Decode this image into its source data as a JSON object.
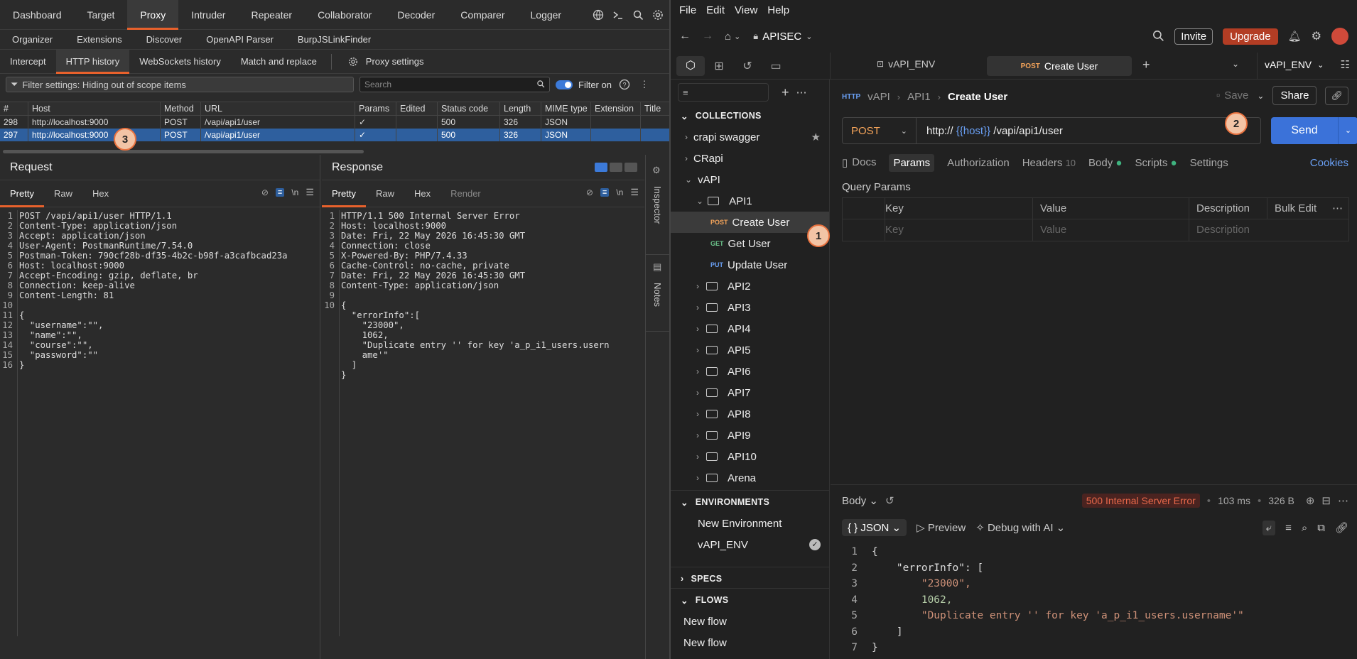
{
  "burp": {
    "top_tabs": [
      "Dashboard",
      "Target",
      "Proxy",
      "Intruder",
      "Repeater",
      "Collaborator",
      "Decoder",
      "Comparer",
      "Logger"
    ],
    "ext_tabs": [
      "Organizer",
      "Extensions",
      "Discover",
      "OpenAPI Parser",
      "BurpJSLinkFinder"
    ],
    "proxy_tabs": [
      "Intercept",
      "HTTP history",
      "WebSockets history",
      "Match and replace"
    ],
    "proxy_settings": "Proxy settings",
    "filter_text": "Filter settings: Hiding out of scope items",
    "search_placeholder": "Search",
    "filter_on": "Filter on",
    "columns": [
      "#",
      "Host",
      "Method",
      "URL",
      "Params",
      "Edited",
      "Status code",
      "Length",
      "MIME type",
      "Extension",
      "Title"
    ],
    "rows": [
      {
        "num": "298",
        "host": "http://localhost:9000",
        "method": "POST",
        "url": "/vapi/api1/user",
        "params": "✓",
        "edited": "",
        "status": "500",
        "length": "326",
        "mime": "JSON"
      },
      {
        "num": "297",
        "host": "http://localhost:9000",
        "method": "POST",
        "url": "/vapi/api1/user",
        "params": "✓",
        "edited": "",
        "status": "500",
        "length": "326",
        "mime": "JSON"
      }
    ],
    "request": {
      "title": "Request",
      "tabs": [
        "Pretty",
        "Raw",
        "Hex"
      ]
    },
    "response": {
      "title": "Response",
      "tabs": [
        "Pretty",
        "Raw",
        "Hex",
        "Render"
      ]
    },
    "request_lines": [
      "POST /vapi/api1/user HTTP/1.1",
      "Content-Type: application/json",
      "Accept: application/json",
      "User-Agent: PostmanRuntime/7.54.0",
      "Postman-Token: 790cf28b-df35-4b2c-b98f-a3cafbcad23a",
      "Host: localhost:9000",
      "Accept-Encoding: gzip, deflate, br",
      "Connection: keep-alive",
      "Content-Length: 81",
      "",
      "{",
      "  \"username\":\"\",",
      "  \"name\":\"\",",
      "  \"course\":\"\",",
      "  \"password\":\"\"",
      "}"
    ],
    "response_lines": [
      "HTTP/1.1 500 Internal Server Error",
      "Host: localhost:9000",
      "Date: Fri, 22 May 2026 16:45:30 GMT",
      "Connection: close",
      "X-Powered-By: PHP/7.4.33",
      "Cache-Control: no-cache, private",
      "Date: Fri, 22 May 2026 16:45:30 GMT",
      "Content-Type: application/json",
      "",
      "{",
      "  \"errorInfo\":[",
      "    \"23000\",",
      "    1062,",
      "    \"Duplicate entry '' for key 'a_p_i1_users.usern",
      "    ame'\"",
      "  ]",
      "}"
    ],
    "response_line_numbers": [
      "1",
      "2",
      "3",
      "4",
      "5",
      "6",
      "7",
      "8",
      "9",
      "10",
      "",
      "",
      "",
      "",
      "",
      "",
      ""
    ],
    "side_labels": [
      "Inspector",
      "Notes"
    ],
    "newline_glyph": "\\n"
  },
  "postman": {
    "menu": [
      "File",
      "Edit",
      "View",
      "Help"
    ],
    "workspace": "APISEC",
    "invite": "Invite",
    "upgrade": "Upgrade",
    "tabs": {
      "env_tab": "vAPI_ENV",
      "req_tab_method": "POST",
      "req_tab_name": "Create User",
      "env_select": "vAPI_ENV"
    },
    "breadcrumb": {
      "a": "vAPI",
      "b": "API1",
      "c": "Create User"
    },
    "save": "Save",
    "share": "Share",
    "method": "POST",
    "url_prefix": "http:// ",
    "url_var": "{{host}}",
    "url_suffix": " /vapi/api1/user",
    "send": "Send",
    "req_tabs": [
      "Docs",
      "Params",
      "Authorization",
      "Headers",
      "Body",
      "Scripts",
      "Settings"
    ],
    "headers_count": "10",
    "cookies": "Cookies",
    "query_params": "Query Params",
    "qp_cols": [
      "Key",
      "Value",
      "Description",
      "Bulk Edit"
    ],
    "qp_placeholders": [
      "Key",
      "Value",
      "Description"
    ],
    "collections_label": "COLLECTIONS",
    "collections": [
      "crapi swagger",
      "CRapi",
      "vAPI",
      "API1"
    ],
    "requests": [
      {
        "m": "POST",
        "n": "Create User"
      },
      {
        "m": "GET",
        "n": "Get User"
      },
      {
        "m": "PUT",
        "n": "Update User"
      }
    ],
    "folders": [
      "API2",
      "API3",
      "API4",
      "API5",
      "API6",
      "API7",
      "API8",
      "API9",
      "API10",
      "Arena"
    ],
    "environments_label": "ENVIRONMENTS",
    "environments": [
      "New Environment",
      "vAPI_ENV"
    ],
    "specs_label": "SPECS",
    "flows_label": "FLOWS",
    "flows": [
      "New flow",
      "New flow"
    ],
    "resp": {
      "body": "Body",
      "status": "500 Internal Server Error",
      "time": "103 ms",
      "size": "326 B",
      "format": "JSON",
      "preview": "Preview",
      "debug": "Debug with AI"
    },
    "resp_lines": [
      "{",
      "    \"errorInfo\": [",
      "        \"23000\",",
      "        1062,",
      "        \"Duplicate entry '' for key 'a_p_i1_users.username'\"",
      "    ]",
      "}"
    ],
    "resp_line_numbers": [
      "1",
      "2",
      "3",
      "4",
      "5",
      "6",
      "7"
    ]
  },
  "badges": [
    "1",
    "2",
    "3"
  ],
  "colors": {
    "burp_accent": "#e8612c",
    "postman_send": "#3b72d9",
    "status_error": "#e8684a",
    "upgrade": "#b33d24"
  }
}
